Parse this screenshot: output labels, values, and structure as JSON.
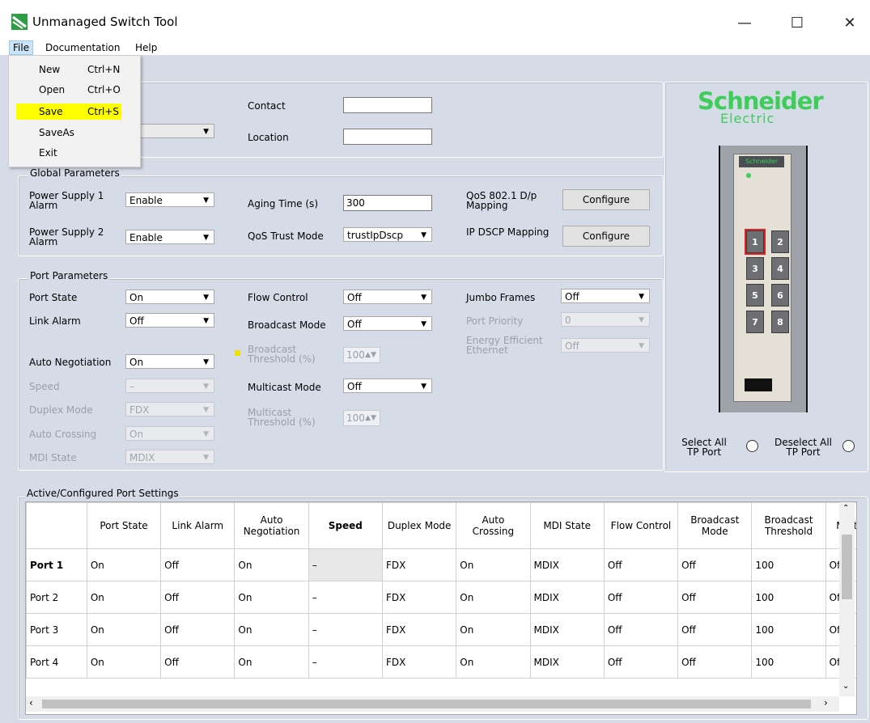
{
  "window": {
    "title": "Unmanaged Switch Tool",
    "controls": [
      "—",
      "☐",
      "✕"
    ]
  },
  "menubar": {
    "items": [
      "File",
      "Documentation",
      "Help"
    ]
  },
  "file_menu": {
    "items": [
      {
        "name": "New",
        "shortcut": "Ctrl+N"
      },
      {
        "name": "Open",
        "shortcut": "Ctrl+O"
      },
      {
        "name": "Save",
        "shortcut": "Ctrl+S"
      },
      {
        "name": "SaveAs",
        "shortcut": ""
      },
      {
        "name": "Exit",
        "shortcut": ""
      }
    ],
    "highlighted": "Save"
  },
  "device_info": {
    "contact_label": "Contact",
    "contact_value": "",
    "location_label": "Location",
    "location_value": ""
  },
  "global": {
    "title": "Global Parameters",
    "ps1_label": "Power Supply 1 Alarm",
    "ps1_value": "Enable",
    "ps2_label": "Power Supply 2 Alarm",
    "ps2_value": "Enable",
    "aging_label": "Aging Time (s)",
    "aging_value": "300",
    "qos_trust_label": "QoS Trust Mode",
    "qos_trust_value": "trustIpDscp",
    "qos_8021_label": "QoS 802.1 D/p Mapping",
    "ip_dscp_label": "IP DSCP Mapping",
    "configure_label": "Configure"
  },
  "port_params": {
    "title": "Port Parameters",
    "port_state_label": "Port State",
    "port_state_value": "On",
    "link_alarm_label": "Link Alarm",
    "link_alarm_value": "Off",
    "auto_neg_label": "Auto Negotiation",
    "auto_neg_value": "On",
    "speed_label": "Speed",
    "speed_value": "–",
    "duplex_label": "Duplex Mode",
    "duplex_value": "FDX",
    "auto_cross_label": "Auto Crossing",
    "auto_cross_value": "On",
    "mdi_label": "MDI State",
    "mdi_value": "MDIX",
    "flow_label": "Flow Control",
    "flow_value": "Off",
    "bcast_mode_label": "Broadcast Mode",
    "bcast_mode_value": "Off",
    "bcast_thr_label": "Broadcast Threshold (%)",
    "bcast_thr_value": "100",
    "mcast_mode_label": "Multicast Mode",
    "mcast_mode_value": "Off",
    "mcast_thr_label": "Multicast Threshold (%)",
    "mcast_thr_value": "100",
    "jumbo_label": "Jumbo Frames",
    "jumbo_value": "Off",
    "priority_label": "Port Priority",
    "priority_value": "0",
    "eee_label": "Energy Efficient Ethernet",
    "eee_value": "Off"
  },
  "brand": {
    "name": "Schneider",
    "sub": "Electric",
    "device_logo": "Schneider",
    "accent": "#3dcd58"
  },
  "ports": [
    "1",
    "2",
    "3",
    "4",
    "5",
    "6",
    "7",
    "8"
  ],
  "selected_port": "1",
  "select_all_label": "Select All TP Port",
  "deselect_all_label": "Deselect All TP Port",
  "table": {
    "title": "Active/Configured Port Settings",
    "headers": [
      "",
      "Port State",
      "Link Alarm",
      "Auto Negotiation",
      "Speed",
      "Duplex Mode",
      "Auto Crossing",
      "MDI State",
      "Flow Control",
      "Broadcast Mode",
      "Broadcast Threshold",
      "Multic Mod"
    ],
    "rows": [
      [
        "Port 1",
        "On",
        "Off",
        "On",
        "–",
        "FDX",
        "On",
        "MDIX",
        "Off",
        "Off",
        "100",
        "Off"
      ],
      [
        "Port 2",
        "On",
        "Off",
        "On",
        "–",
        "FDX",
        "On",
        "MDIX",
        "Off",
        "Off",
        "100",
        "Off"
      ],
      [
        "Port 3",
        "On",
        "Off",
        "On",
        "–",
        "FDX",
        "On",
        "MDIX",
        "Off",
        "Off",
        "100",
        "Off"
      ],
      [
        "Port 4",
        "On",
        "Off",
        "On",
        "–",
        "FDX",
        "On",
        "MDIX",
        "Off",
        "Off",
        "100",
        "Off"
      ]
    ]
  }
}
